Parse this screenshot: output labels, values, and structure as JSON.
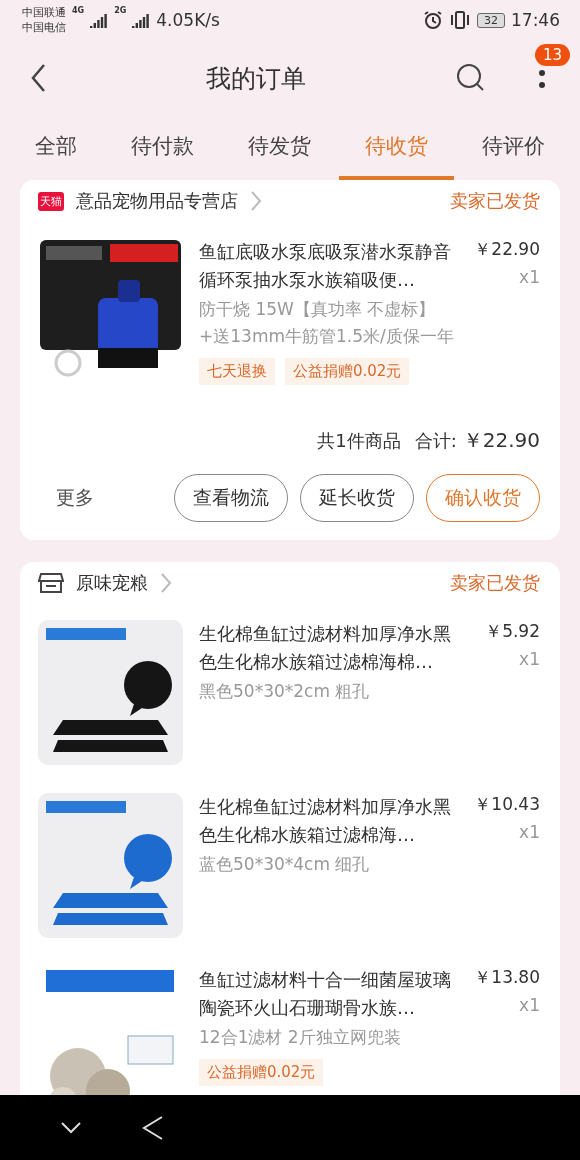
{
  "status_bar": {
    "carriers": [
      "中国联通",
      "中国电信"
    ],
    "network_tags": [
      "4G",
      "2G"
    ],
    "speed": "4.05K/s",
    "battery": "32",
    "time": "17:46"
  },
  "header": {
    "title": "我的订单",
    "badge": "13"
  },
  "tabs": [
    {
      "label": "全部",
      "selected": false
    },
    {
      "label": "待付款",
      "selected": false
    },
    {
      "label": "待发货",
      "selected": false
    },
    {
      "label": "待收货",
      "selected": true
    },
    {
      "label": "待评价",
      "selected": false
    }
  ],
  "orders": [
    {
      "store": {
        "kind": "tmall",
        "badge": "天猫",
        "name": "意品宠物用品专营店"
      },
      "status": "卖家已发货",
      "items": [
        {
          "kind": "picture",
          "title": "鱼缸底吸水泵底吸泵潜水泵静音循环泵抽水泵水族箱吸便…",
          "spec": "防干烧 15W【真功率 不虚标】+送13mm牛筋管1.5米/质保一年",
          "tags": [
            "七天退换",
            "公益捐赠0.02元"
          ],
          "price": "￥22.90",
          "qty": "x1"
        }
      ],
      "summary": {
        "count": "共1件商品",
        "total_label": "合计:",
        "total": "￥22.90"
      },
      "more": "更多",
      "actions": [
        {
          "label": "查看物流",
          "primary": false
        },
        {
          "label": "延长收货",
          "primary": false
        },
        {
          "label": "确认收货",
          "primary": true
        }
      ]
    },
    {
      "store": {
        "kind": "shop",
        "name": "原味宠粮"
      },
      "status": "卖家已发货",
      "items": [
        {
          "kind": "picture",
          "title": "生化棉鱼缸过滤材料加厚净水黑色生化棉水族箱过滤棉海棉…",
          "spec": "黑色50*30*2cm 粗孔",
          "price": "￥5.92",
          "qty": "x1"
        },
        {
          "kind": "picture",
          "title": "生化棉鱼缸过滤材料加厚净水黑色生化棉水族箱过滤棉海…",
          "spec": "蓝色50*30*4cm 细孔",
          "price": "￥10.43",
          "qty": "x1"
        },
        {
          "kind": "picture",
          "title": "鱼缸过滤材料十合一细菌屋玻璃陶瓷环火山石珊瑚骨水族…",
          "spec": "12合1滤材 2斤独立网兜装",
          "tags": [
            "公益捐赠0.02元"
          ],
          "price": "￥13.80",
          "qty": "x1"
        }
      ]
    }
  ]
}
